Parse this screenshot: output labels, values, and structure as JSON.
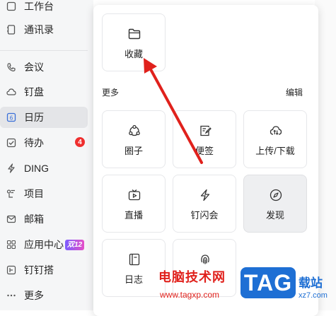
{
  "sidebar": {
    "items": [
      {
        "label": "工作台",
        "icon": "workbench-icon"
      },
      {
        "label": "通讯录",
        "icon": "contacts-icon"
      },
      {
        "label": "会议",
        "icon": "meeting-icon"
      },
      {
        "label": "钉盘",
        "icon": "cloud-drive-icon"
      },
      {
        "label": "日历",
        "icon": "calendar-icon",
        "active": true
      },
      {
        "label": "待办",
        "icon": "todo-icon",
        "badge": "4"
      },
      {
        "label": "DING",
        "icon": "ding-icon"
      },
      {
        "label": "项目",
        "icon": "project-icon"
      },
      {
        "label": "邮箱",
        "icon": "mail-icon"
      },
      {
        "label": "应用中心",
        "icon": "app-center-icon",
        "promo": "双12"
      },
      {
        "label": "钉钉搭",
        "icon": "dingtalk-builder-icon"
      },
      {
        "label": "更多",
        "icon": "more-icon"
      }
    ]
  },
  "popup": {
    "pinned": [
      {
        "label": "收藏",
        "icon": "favorites-folder-icon"
      }
    ],
    "more_label": "更多",
    "edit_label": "编辑",
    "tiles": [
      {
        "label": "圈子",
        "icon": "circle-group-icon"
      },
      {
        "label": "便签",
        "icon": "note-icon"
      },
      {
        "label": "上传/下载",
        "icon": "upload-download-icon"
      },
      {
        "label": "直播",
        "icon": "live-tv-icon"
      },
      {
        "label": "钉闪会",
        "icon": "flash-meeting-icon"
      },
      {
        "label": "发现",
        "icon": "compass-icon",
        "selected": true
      },
      {
        "label": "日志",
        "icon": "log-icon"
      },
      {
        "label": "",
        "icon": "fingerprint-icon"
      }
    ]
  },
  "watermark": {
    "site_name": "电脑技术网",
    "site_url": "www.tagxp.com",
    "logo_text": "TAG",
    "site_name_2": "载站",
    "site_url_2": "xz7.com"
  },
  "colors": {
    "accent_blue": "#1e6fd4",
    "badge_red": "#ef2f2f",
    "arrow_red": "#e0211c",
    "selected_tile_bg": "#eeeff1"
  }
}
